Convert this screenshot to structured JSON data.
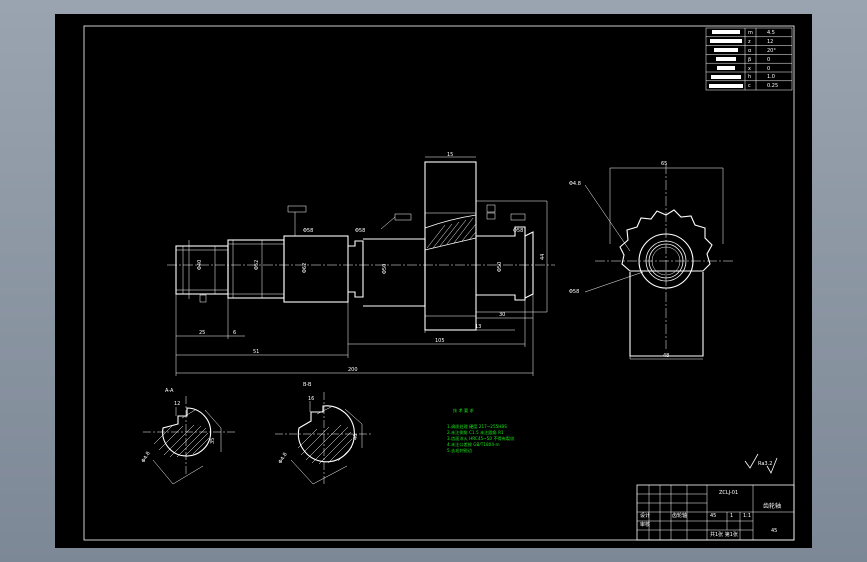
{
  "colors": {
    "background": "#000000",
    "frame": "#8c98a6",
    "line": "#ffffff",
    "notes": "#19e619"
  },
  "param_table": [
    {
      "name": "",
      "symbol": "m",
      "value": "4.5"
    },
    {
      "name": "",
      "symbol": "z",
      "value": "12"
    },
    {
      "name": "",
      "symbol": "α",
      "value": "20°"
    },
    {
      "name": "",
      "symbol": "β",
      "value": "0"
    },
    {
      "name": "",
      "symbol": "x",
      "value": "0"
    },
    {
      "name": "",
      "symbol": "h",
      "value": "1.0"
    },
    {
      "name": "",
      "symbol": "c",
      "value": "0.25"
    }
  ],
  "dimensions": {
    "d_left": "Φ40",
    "d_mid": "Φ52",
    "d_shoulder": "Φ62",
    "d_right": "Φ50",
    "len_25": "25",
    "len_b": "6",
    "len_51": "51",
    "len_105": "105",
    "len_13": "13",
    "len_30": "30",
    "len_200": "200",
    "len_90": "90",
    "len_15": "15",
    "len_44": "44",
    "gear_dim": "65",
    "gear_bot": "48",
    "leader_a": "Φ4.8",
    "leader_b": "Φ58",
    "section_a": "A-A",
    "section_b": "B-B",
    "section_a_w": "12",
    "section_a_d": "35",
    "section_b_w": "16",
    "section_b_d": "46",
    "roughness": "Ra3.2"
  },
  "notes": {
    "title": "技 术 要 求",
    "lines": [
      "1.调质处理 硬度 217~255HBS",
      "2.未注倒角 C1.5 未注圆角 R1",
      "3.齿面淬火 HRC45~50 不得有裂纹",
      "4.未注公差按 GB/T1804-m",
      "5.去毛刺锐边"
    ]
  },
  "title_block": {
    "part_name": "齿轮轴",
    "material": "45",
    "scale": "1:1",
    "drawing_no": "ZCLJ-01",
    "sheet": "共1张 第1张",
    "count": "1",
    "weight": "",
    "designer": "设计",
    "checker": "审核",
    "company": "齿轮轴"
  }
}
